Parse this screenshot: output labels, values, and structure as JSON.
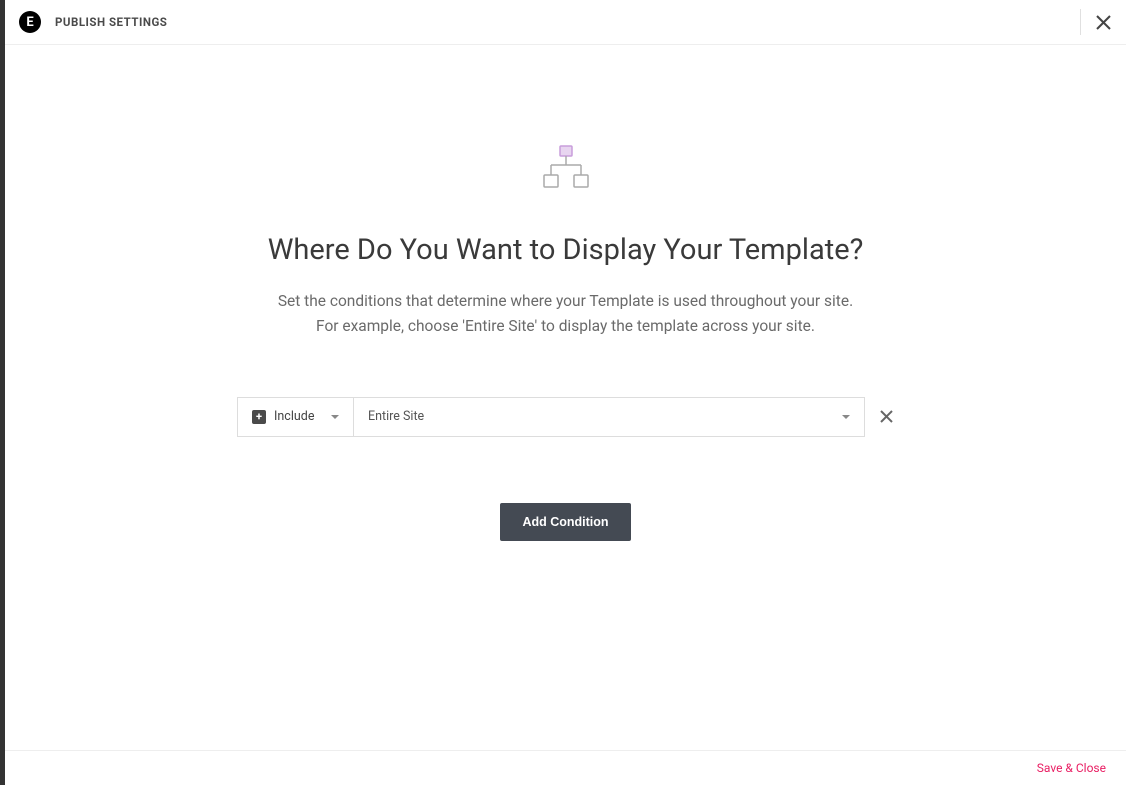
{
  "header": {
    "logo_text": "E",
    "title": "PUBLISH SETTINGS"
  },
  "main": {
    "heading": "Where Do You Want to Display Your Template?",
    "description_line1": "Set the conditions that determine where your Template is used throughout your site.",
    "description_line2": "For example, choose 'Entire Site' to display the template across your site.",
    "condition": {
      "mode": "Include",
      "location": "Entire Site"
    },
    "add_condition_label": "Add Condition"
  },
  "footer": {
    "save_close_label": "Save & Close"
  }
}
